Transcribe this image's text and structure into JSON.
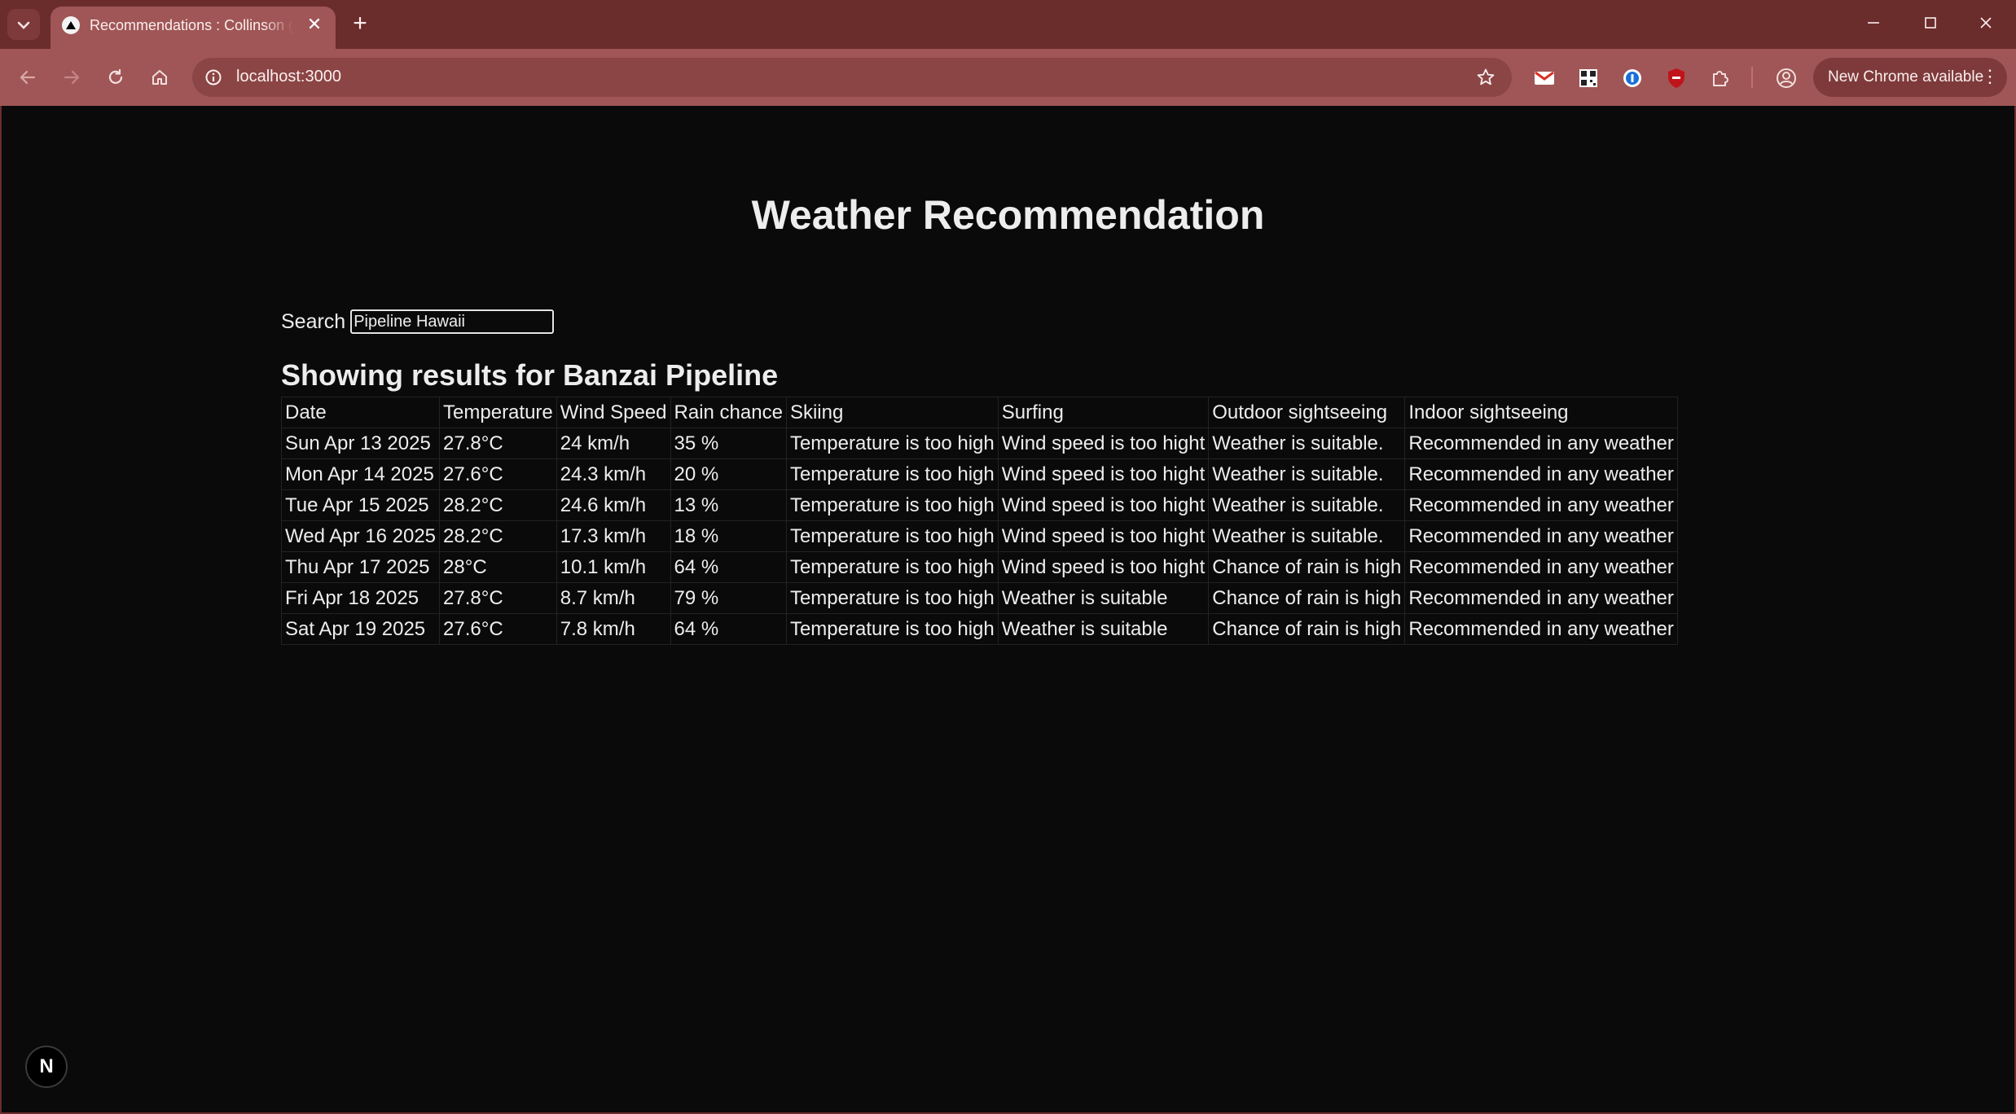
{
  "browser": {
    "tab_title": "Recommendations : Collinson group",
    "url": "localhost:3000",
    "update_label": "New Chrome available",
    "tab_close_glyph": "✕",
    "new_tab_glyph": "+",
    "menu_glyph": "⋮",
    "tab_list_glyph": "⌄"
  },
  "page": {
    "title": "Weather Recommendation",
    "search_label": "Search",
    "search_value": "Pipeline Hawaii",
    "results_heading": "Showing results for Banzai Pipeline"
  },
  "table": {
    "headers": [
      "Date",
      "Temperature",
      "Wind Speed",
      "Rain chance",
      "Skiing",
      "Surfing",
      "Outdoor sightseeing",
      "Indoor sightseeing"
    ],
    "rows": [
      [
        "Sun Apr 13 2025",
        "27.8°C",
        "24 km/h",
        "35 %",
        "Temperature is too high",
        "Wind speed is too hight",
        "Weather is suitable.",
        "Recommended in any weather"
      ],
      [
        "Mon Apr 14 2025",
        "27.6°C",
        "24.3 km/h",
        "20 %",
        "Temperature is too high",
        "Wind speed is too hight",
        "Weather is suitable.",
        "Recommended in any weather"
      ],
      [
        "Tue Apr 15 2025",
        "28.2°C",
        "24.6 km/h",
        "13 %",
        "Temperature is too high",
        "Wind speed is too hight",
        "Weather is suitable.",
        "Recommended in any weather"
      ],
      [
        "Wed Apr 16 2025",
        "28.2°C",
        "17.3 km/h",
        "18 %",
        "Temperature is too high",
        "Wind speed is too hight",
        "Weather is suitable.",
        "Recommended in any weather"
      ],
      [
        "Thu Apr 17 2025",
        "28°C",
        "10.1 km/h",
        "64 %",
        "Temperature is too high",
        "Wind speed is too hight",
        "Chance of rain is high",
        "Recommended in any weather"
      ],
      [
        "Fri Apr 18 2025",
        "27.8°C",
        "8.7 km/h",
        "79 %",
        "Temperature is too high",
        "Weather is suitable",
        "Chance of rain is high",
        "Recommended in any weather"
      ],
      [
        "Sat Apr 19 2025",
        "27.6°C",
        "7.8 km/h",
        "64 %",
        "Temperature is too high",
        "Weather is suitable",
        "Chance of rain is high",
        "Recommended in any weather"
      ]
    ]
  },
  "dev_badge": {
    "label": "N"
  },
  "colors": {
    "chrome_dark": "#6b2c2c",
    "chrome_light": "#a05656",
    "page_bg": "#0a0a0a",
    "text": "#ededed"
  },
  "icons": {
    "tab_list": "chevron-down-icon",
    "favicon": "triangle-icon",
    "back": "arrow-left-icon",
    "forward": "arrow-right-icon",
    "reload": "reload-icon",
    "home": "home-icon",
    "site_info": "info-icon",
    "bookmark": "star-icon",
    "extensions": [
      "gmail-icon",
      "qr-code-icon",
      "password-manager-icon",
      "shield-icon",
      "puzzle-icon"
    ],
    "profile": "profile-icon"
  }
}
